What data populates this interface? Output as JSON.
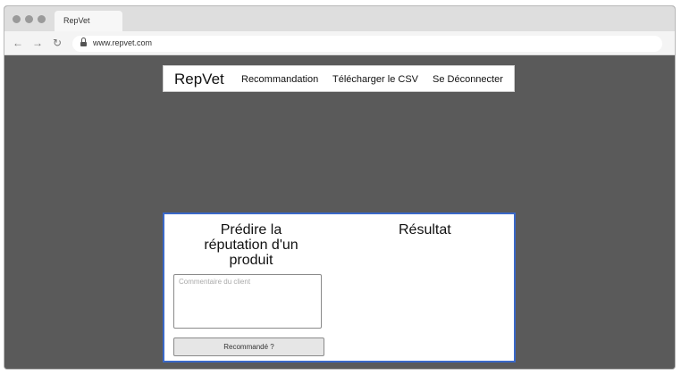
{
  "browser": {
    "tab_title": "RepVet",
    "url": "www.repvet.com",
    "icons": [
      "back-arrow-icon",
      "forward-arrow-icon",
      "reload-icon",
      "lock-icon"
    ]
  },
  "navbar": {
    "brand": "RepVet",
    "links": [
      {
        "label": "Recommandation"
      },
      {
        "label": "Télécharger le CSV"
      },
      {
        "label": "Se Déconnecter"
      }
    ]
  },
  "predict": {
    "title": "Prédire la réputation d'un produit",
    "comment_placeholder": "Commentaire du client",
    "comment_value": "",
    "button_label": "Recommandé ?"
  },
  "result": {
    "title": "Résultat"
  },
  "colors": {
    "page_background": "#5a5a5a",
    "card_border": "#3a68c8",
    "chrome_background": "#dedede"
  }
}
